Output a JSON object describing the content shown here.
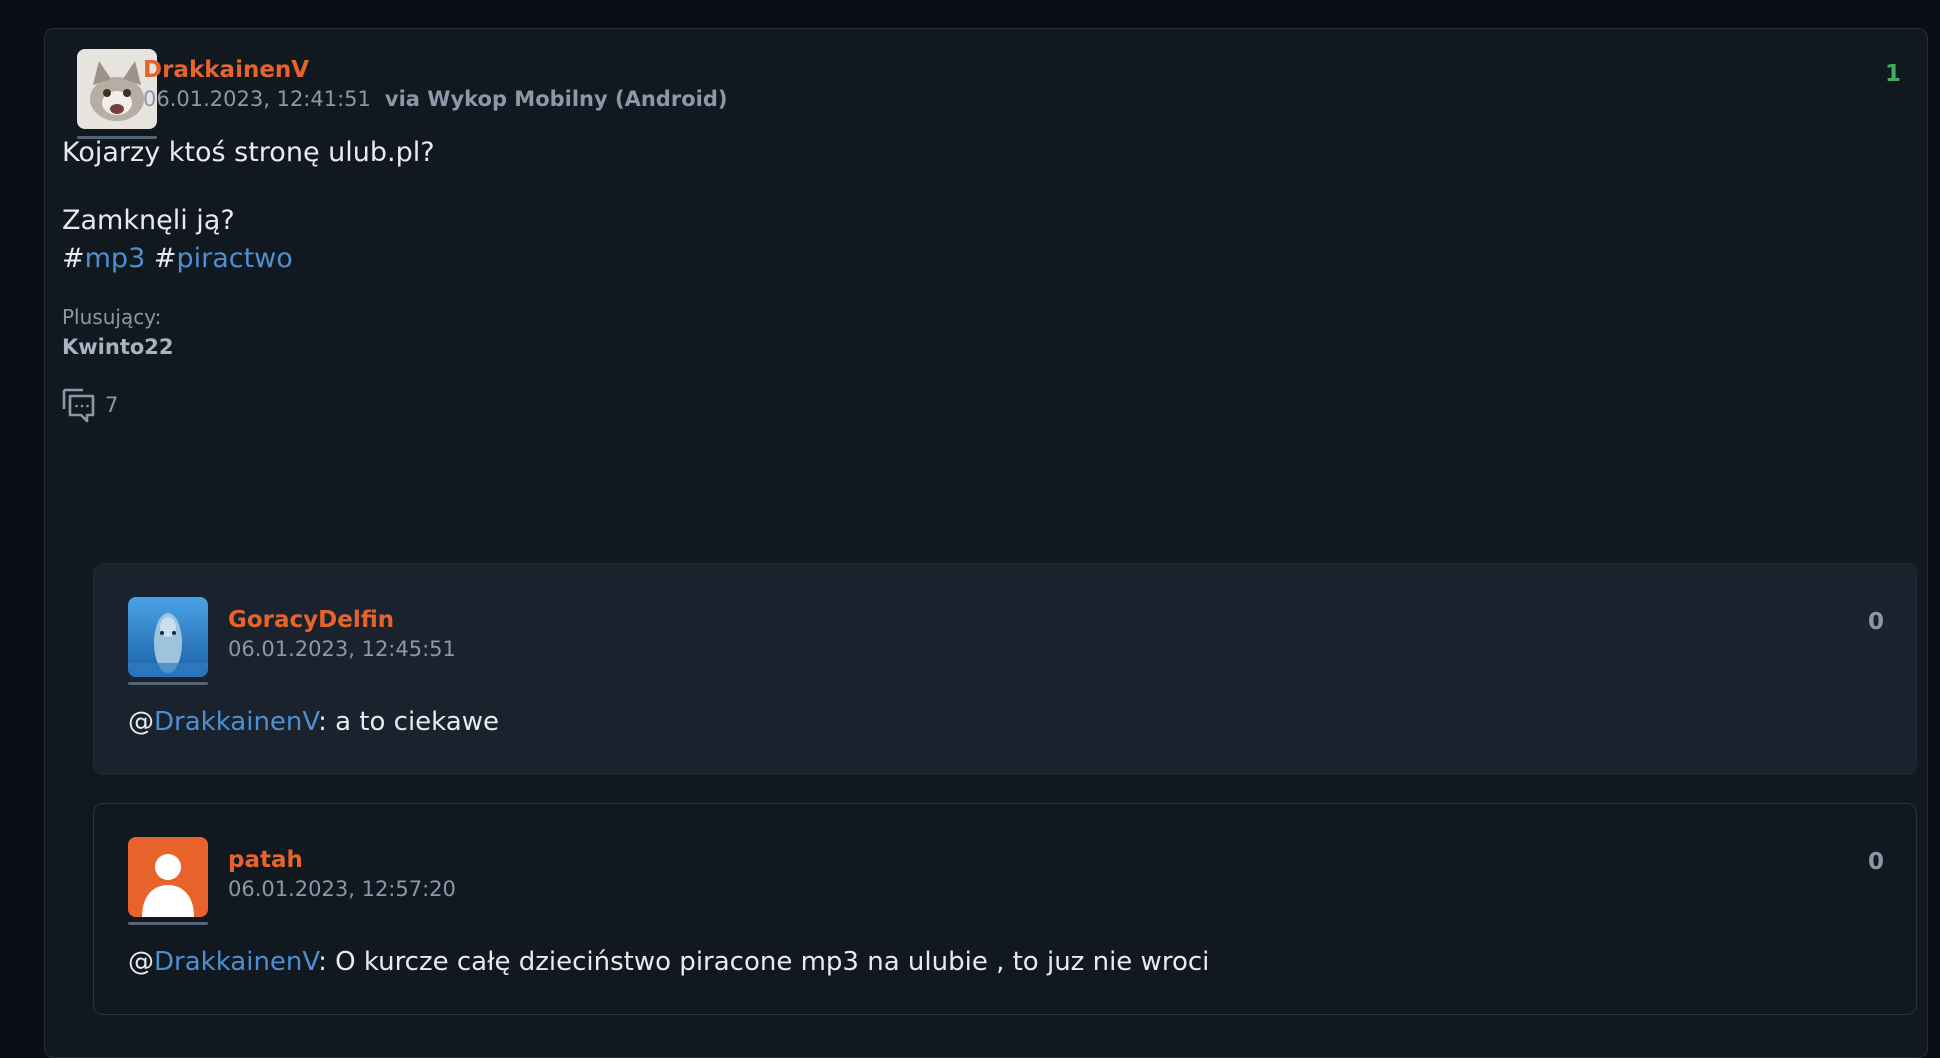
{
  "post": {
    "author": "DrakkainenV",
    "timestamp": "06.01.2023, 12:41:51",
    "via": "via Wykop Mobilny (Android)",
    "score": "1",
    "line1": "Kojarzy ktoś stronę ulub.pl?",
    "line2": "Zamknęli ją?",
    "tags": [
      {
        "hash": "#",
        "name": "mp3"
      },
      {
        "hash": "#",
        "name": "piractwo"
      }
    ],
    "plus_label": "Plusujący:",
    "plus_users": "Kwinto22",
    "comment_count": "7",
    "comment_icon": "comments-icon"
  },
  "replies": [
    {
      "author": "GoracyDelfin",
      "timestamp": "06.01.2023, 12:45:51",
      "score": "0",
      "mention_at": "@",
      "mention": "DrakkainenV",
      "text": ": a to ciekawe"
    },
    {
      "author": "patah",
      "timestamp": "06.01.2023, 12:57:20",
      "score": "0",
      "mention_at": "@",
      "mention": "DrakkainenV",
      "text": ": O kurcze całę dzieciństwo piracone mp3 na ulubie , to juz nie wroci"
    }
  ],
  "colors": {
    "author": "#e8632b",
    "link": "#4d8fd1",
    "positive_score": "#3fae5e",
    "neutral_score": "#8a98a8"
  }
}
